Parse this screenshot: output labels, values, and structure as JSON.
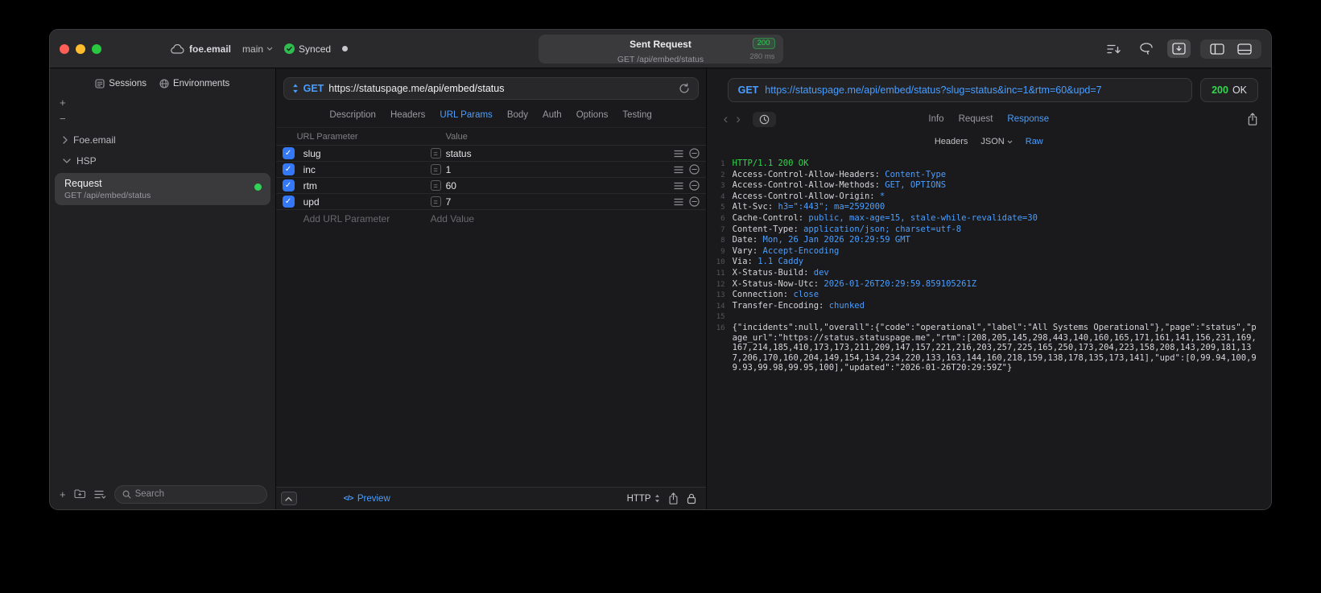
{
  "glyphs": {
    "plus": "+",
    "minus": "−",
    "check": "✓",
    "back": "‹",
    "forward": "›",
    "code": "</>",
    "equals": "="
  },
  "colors": {
    "accent_blue": "#4a9eff",
    "success_green": "#32d74b",
    "badge_green": "#30d158"
  },
  "titlebar": {
    "account": "foe.email",
    "branch": "main",
    "sync_label": "Synced",
    "title": "Sent Request",
    "status_badge": "200",
    "subtitle": "GET /api/embed/status",
    "duration": "280 ms"
  },
  "sidebar": {
    "tabs": [
      {
        "label": "Sessions"
      },
      {
        "label": "Environments"
      }
    ],
    "tree": [
      {
        "label": "Foe.email",
        "expanded": false
      },
      {
        "label": "HSP",
        "expanded": true
      }
    ],
    "request": {
      "title": "Request",
      "subtitle": "GET /api/embed/status"
    },
    "search_placeholder": "Search"
  },
  "request_editor": {
    "method": "GET",
    "url_host": "https://statuspage.me",
    "url_path": "/api/embed/status",
    "tabs": [
      "Description",
      "Headers",
      "URL Params",
      "Body",
      "Auth",
      "Options",
      "Testing"
    ],
    "active_tab": "URL Params",
    "table": {
      "columns": [
        "URL Parameter",
        "Value"
      ],
      "rows": [
        {
          "enabled": true,
          "name": "slug",
          "value": "status"
        },
        {
          "enabled": true,
          "name": "inc",
          "value": "1"
        },
        {
          "enabled": true,
          "name": "rtm",
          "value": "60"
        },
        {
          "enabled": true,
          "name": "upd",
          "value": "7"
        }
      ],
      "add_name_placeholder": "Add URL Parameter",
      "add_value_placeholder": "Add Value"
    },
    "footer": {
      "preview": "Preview",
      "protocol": "HTTP"
    }
  },
  "response_viewer": {
    "method": "GET",
    "url": "https://statuspage.me/api/embed/status?slug=status&inc=1&rtm=60&upd=7",
    "status_code": "200",
    "status_text": "OK",
    "tabs": [
      "Info",
      "Request",
      "Response"
    ],
    "active_tab": "Response",
    "subtabs": [
      {
        "label": "Headers",
        "active": false,
        "chevron": false
      },
      {
        "label": "JSON",
        "active": false,
        "chevron": true
      },
      {
        "label": "Raw",
        "active": true,
        "chevron": false
      }
    ],
    "body_lines": [
      {
        "n": "1",
        "segs": [
          {
            "t": "HTTP/1.1 200 OK",
            "c": "green"
          }
        ]
      },
      {
        "n": "2",
        "segs": [
          {
            "t": "Access-Control-Allow-Headers: ",
            "c": "plain"
          },
          {
            "t": "Content-Type",
            "c": "blue"
          }
        ]
      },
      {
        "n": "3",
        "segs": [
          {
            "t": "Access-Control-Allow-Methods: ",
            "c": "plain"
          },
          {
            "t": "GET, OPTIONS",
            "c": "blue"
          }
        ]
      },
      {
        "n": "4",
        "segs": [
          {
            "t": "Access-Control-Allow-Origin: ",
            "c": "plain"
          },
          {
            "t": "*",
            "c": "blue"
          }
        ]
      },
      {
        "n": "5",
        "segs": [
          {
            "t": "Alt-Svc: ",
            "c": "plain"
          },
          {
            "t": "h3=\":443\"; ma=2592000",
            "c": "blue"
          }
        ]
      },
      {
        "n": "6",
        "segs": [
          {
            "t": "Cache-Control: ",
            "c": "plain"
          },
          {
            "t": "public, max-age=15, stale-while-revalidate=30",
            "c": "blue"
          }
        ]
      },
      {
        "n": "7",
        "segs": [
          {
            "t": "Content-Type: ",
            "c": "plain"
          },
          {
            "t": "application/json; charset=utf-8",
            "c": "blue"
          }
        ]
      },
      {
        "n": "8",
        "segs": [
          {
            "t": "Date: ",
            "c": "plain"
          },
          {
            "t": "Mon, 26 Jan 2026 20:29:59 GMT",
            "c": "blue"
          }
        ]
      },
      {
        "n": "9",
        "segs": [
          {
            "t": "Vary: ",
            "c": "plain"
          },
          {
            "t": "Accept-Encoding",
            "c": "blue"
          }
        ]
      },
      {
        "n": "10",
        "segs": [
          {
            "t": "Via: ",
            "c": "plain"
          },
          {
            "t": "1.1 Caddy",
            "c": "blue"
          }
        ]
      },
      {
        "n": "11",
        "segs": [
          {
            "t": "X-Status-Build: ",
            "c": "plain"
          },
          {
            "t": "dev",
            "c": "blue"
          }
        ]
      },
      {
        "n": "12",
        "segs": [
          {
            "t": "X-Status-Now-Utc: ",
            "c": "plain"
          },
          {
            "t": "2026-01-26T20:29:59.859105261Z",
            "c": "blue"
          }
        ]
      },
      {
        "n": "13",
        "segs": [
          {
            "t": "Connection: ",
            "c": "plain"
          },
          {
            "t": "close",
            "c": "blue"
          }
        ]
      },
      {
        "n": "14",
        "segs": [
          {
            "t": "Transfer-Encoding: ",
            "c": "plain"
          },
          {
            "t": "chunked",
            "c": "blue"
          }
        ]
      },
      {
        "n": "15",
        "segs": []
      },
      {
        "n": "16",
        "segs": [
          {
            "t": "{\"incidents\":null,\"overall\":{\"code\":\"operational\",\"label\":\"All Systems Operational\"},\"page\":\"status\",\"page_url\":\"https://status.statuspage.me\",\"rtm\":[208,205,145,298,443,140,160,165,171,161,141,156,231,169,167,214,185,410,173,173,211,209,147,157,221,216,203,257,225,165,250,173,204,223,158,208,143,209,181,137,206,170,160,204,149,154,134,234,220,133,163,144,160,218,159,138,178,135,173,141],\"upd\":[0,99.94,100,99.93,99.98,99.95,100],\"updated\":\"2026-01-26T20:29:59Z\"}",
            "c": "plain"
          }
        ]
      }
    ]
  }
}
